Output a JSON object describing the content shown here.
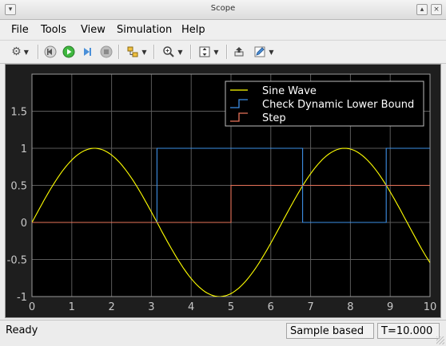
{
  "window": {
    "title": "Scope"
  },
  "menu": [
    {
      "label": "File",
      "name": "menu-file"
    },
    {
      "label": "Tools",
      "name": "menu-tools"
    },
    {
      "label": "View",
      "name": "menu-view"
    },
    {
      "label": "Simulation",
      "name": "menu-simulation"
    },
    {
      "label": "Help",
      "name": "menu-help"
    }
  ],
  "toolbar_icons": [
    "gear-icon",
    "step-back-icon",
    "run-icon",
    "step-forward-icon",
    "stop-icon",
    "highlight-icon",
    "zoom-icon",
    "scale-icon",
    "undock-icon",
    "edit-icon"
  ],
  "status": {
    "left": "Ready",
    "mode": "Sample based",
    "time": "T=10.000"
  },
  "chart_data": {
    "type": "line",
    "title": "",
    "xlabel": "",
    "ylabel": "",
    "xlim": [
      0,
      10
    ],
    "ylim": [
      -1,
      2
    ],
    "x_ticks": [
      "0",
      "1",
      "2",
      "3",
      "4",
      "5",
      "6",
      "7",
      "8",
      "9",
      "10"
    ],
    "y_ticks": [
      "-1",
      "-0.5",
      "0",
      "0.5",
      "1",
      "1.5"
    ],
    "grid": true,
    "legend_position": "top-right",
    "colors": {
      "background": "#000000",
      "grid": "#5a5a5a",
      "axes_text": "#c8c8c8"
    },
    "series": [
      {
        "name": "Sine Wave",
        "color": "#ffff00",
        "style": "line",
        "function": "sin(t)",
        "x": [
          0,
          0.5,
          1,
          1.5708,
          2,
          2.5,
          3,
          3.5,
          4,
          4.7124,
          5,
          5.5,
          6,
          6.5,
          7,
          7.854,
          8,
          8.5,
          9,
          9.5,
          10
        ],
        "y": [
          0,
          0.479,
          0.841,
          1,
          0.909,
          0.598,
          0.141,
          -0.351,
          -0.757,
          -1,
          -0.959,
          -0.706,
          -0.279,
          0.215,
          0.657,
          1,
          0.989,
          0.798,
          0.412,
          -0.075,
          -0.544
        ]
      },
      {
        "name": "Check Dynamic  Lower Bound",
        "color": "#3d8fe6",
        "style": "step",
        "x": [
          0,
          3.14,
          3.14,
          6.8,
          6.8,
          8.9,
          8.9,
          10
        ],
        "y": [
          0,
          0,
          1,
          1,
          0,
          0,
          1,
          1
        ]
      },
      {
        "name": "Step",
        "color": "#e8735a",
        "style": "step",
        "x": [
          0,
          5,
          5,
          10
        ],
        "y": [
          0,
          0,
          0.5,
          0.5
        ]
      }
    ]
  }
}
